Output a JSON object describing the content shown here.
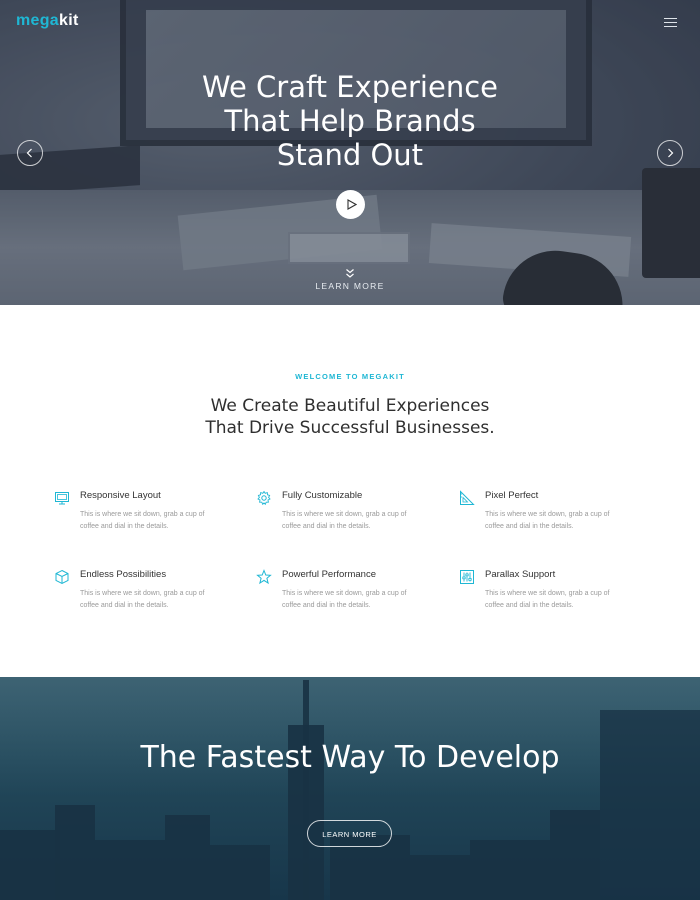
{
  "brand": {
    "part1": "mega",
    "part2": "kit"
  },
  "hero": {
    "title_lines": [
      "We Craft Experience",
      "That Help Brands",
      "Stand Out"
    ],
    "learn_more": "LEARN MORE"
  },
  "features_section": {
    "eyebrow": "WELCOME TO MEGAKIT",
    "title_lines": [
      "We Create Beautiful Experiences",
      "That Drive Successful Businesses."
    ],
    "items": [
      {
        "icon": "monitor-icon",
        "title": "Responsive Layout",
        "desc": "This is where we sit down, grab a cup of coffee and dial in the details."
      },
      {
        "icon": "gear-icon",
        "title": "Fully Customizable",
        "desc": "This is where we sit down, grab a cup of coffee and dial in the details."
      },
      {
        "icon": "set-square-icon",
        "title": "Pixel Perfect",
        "desc": "This is where we sit down, grab a cup of coffee and dial in the details."
      },
      {
        "icon": "cube-icon",
        "title": "Endless Possibilities",
        "desc": "This is where we sit down, grab a cup of coffee and dial in the details."
      },
      {
        "icon": "star-icon",
        "title": "Powerful Performance",
        "desc": "This is where we sit down, grab a cup of coffee and dial in the details."
      },
      {
        "icon": "sliders-icon",
        "title": "Parallax Support",
        "desc": "This is where we sit down, grab a cup of coffee and dial in the details."
      }
    ]
  },
  "cta": {
    "title": "The Fastest Way To Develop",
    "button": "LEARN MORE"
  },
  "colors": {
    "accent": "#1fb7d4",
    "text_dark": "#333333",
    "text_muted": "#9a9a9a"
  }
}
